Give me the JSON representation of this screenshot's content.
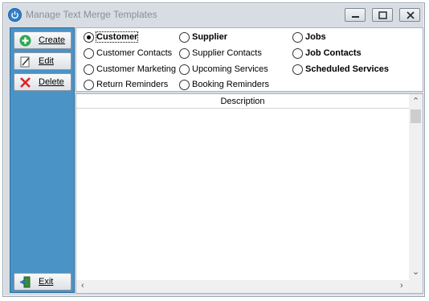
{
  "window": {
    "title": "Manage Text Merge Templates"
  },
  "sidebar": {
    "create_label": "Create",
    "edit_label": "Edit",
    "delete_label": "Delete",
    "exit_label": "Exit"
  },
  "options": {
    "items": [
      {
        "label": "Customer",
        "checked": true,
        "bold": true
      },
      {
        "label": "Supplier",
        "checked": false,
        "bold": true
      },
      {
        "label": "Jobs",
        "checked": false,
        "bold": true
      },
      {
        "label": "Customer Contacts",
        "checked": false,
        "bold": false
      },
      {
        "label": "Supplier Contacts",
        "checked": false,
        "bold": false
      },
      {
        "label": "Job Contacts",
        "checked": false,
        "bold": true
      },
      {
        "label": "Customer Marketing",
        "checked": false,
        "bold": false
      },
      {
        "label": "Upcoming Services",
        "checked": false,
        "bold": false
      },
      {
        "label": "Scheduled Services",
        "checked": false,
        "bold": true
      },
      {
        "label": "Return Reminders",
        "checked": false,
        "bold": false
      },
      {
        "label": "Booking Reminders",
        "checked": false,
        "bold": false
      }
    ]
  },
  "grid": {
    "column_header": "Description",
    "rows": []
  },
  "colors": {
    "sidebar_bg": "#4a93c6",
    "window_bg": "#d8dde3",
    "app_icon": "#2f7fcb"
  },
  "icons": {
    "app": "power-icon",
    "create": "plus-circle-icon",
    "edit": "pencil-page-icon",
    "delete": "red-x-icon",
    "exit": "door-exit-icon"
  }
}
